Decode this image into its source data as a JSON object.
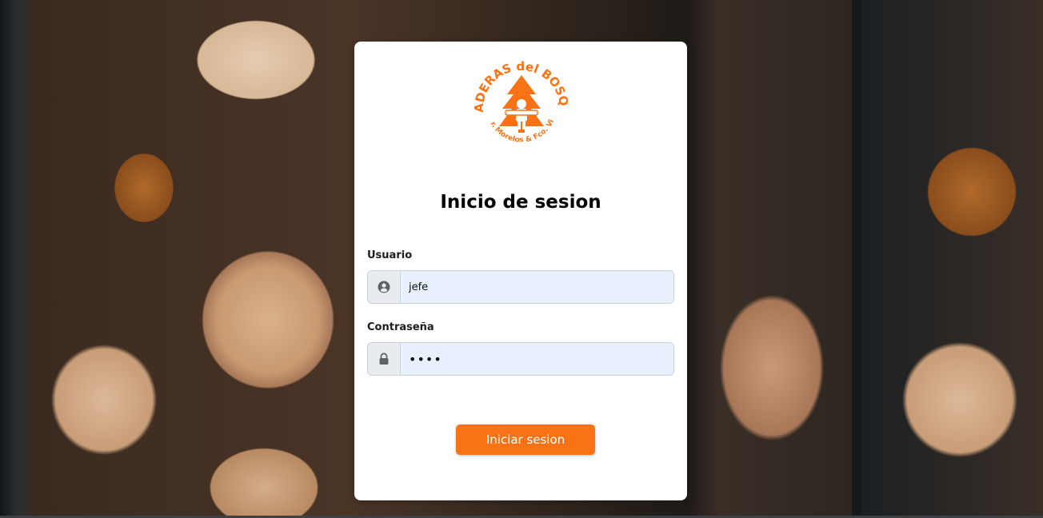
{
  "logo": {
    "brand_top": "MADERAS del BOSQUE",
    "brand_bottom": "Blvr. Morelos & Fco. Villa",
    "color": "#f97316"
  },
  "login": {
    "title": "Inicio de sesion",
    "user_label": "Usuario",
    "user_value": "jefe",
    "user_icon": "user-circle-icon",
    "pass_label": "Contraseña",
    "pass_value": "••••",
    "pass_icon": "lock-icon",
    "submit_label": "Iniciar sesion"
  }
}
